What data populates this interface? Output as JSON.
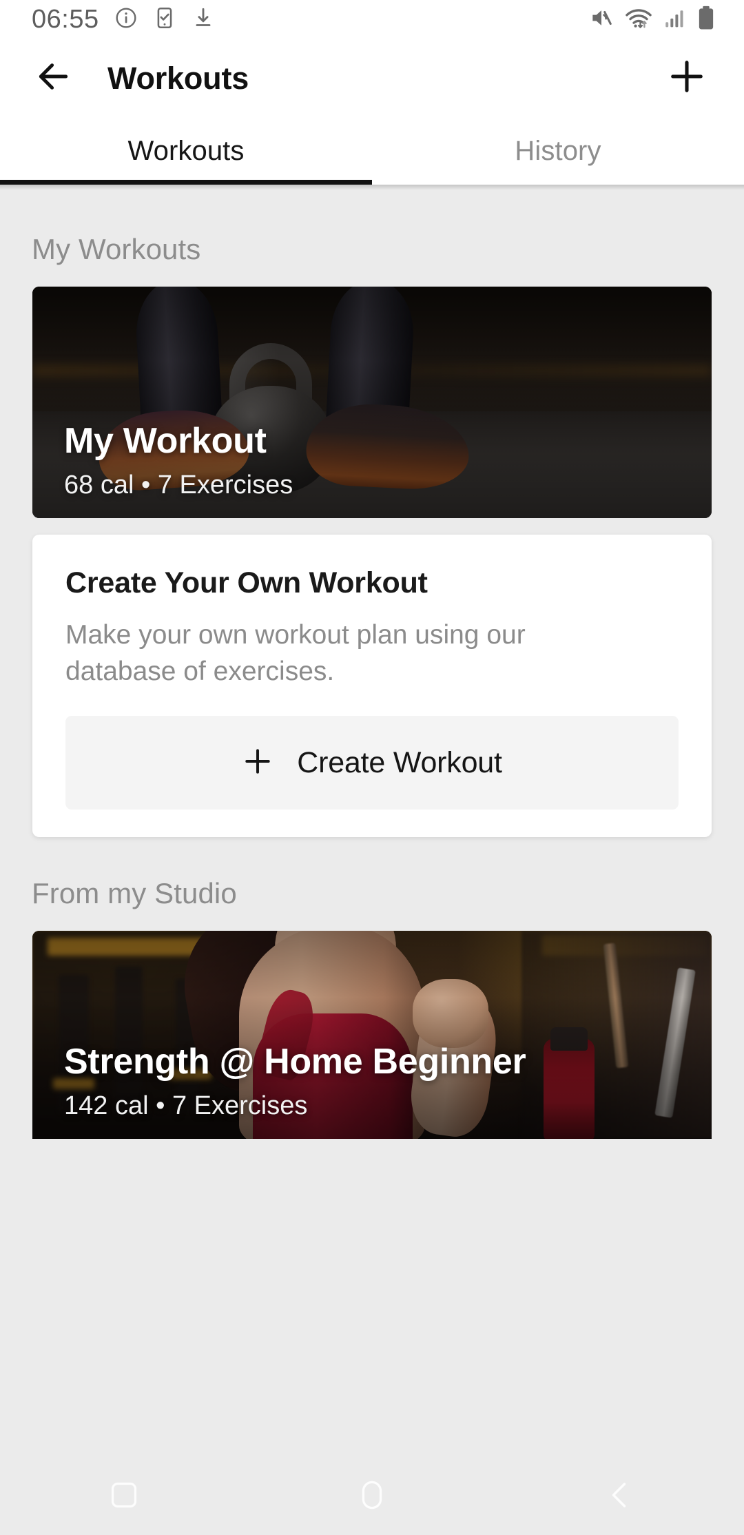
{
  "status_bar": {
    "time": "06:55",
    "left_icons": [
      "info-icon",
      "tasks-icon",
      "download-icon"
    ],
    "right_icons": [
      "mute-icon",
      "wifi-icon",
      "signal-icon",
      "battery-icon"
    ]
  },
  "app_bar": {
    "back_icon": "back-arrow-icon",
    "title": "Workouts",
    "add_icon": "plus-icon"
  },
  "tabs": {
    "items": [
      {
        "label": "Workouts",
        "active": true
      },
      {
        "label": "History",
        "active": false
      }
    ]
  },
  "sections": [
    {
      "title": "My Workouts",
      "hero": {
        "title": "My Workout",
        "subtitle": "68 cal • 7 Exercises",
        "calories": "68 cal",
        "exercises": "7 Exercises"
      },
      "create_card": {
        "title": "Create Your Own Workout",
        "description": "Make your own workout plan using our database of exercises.",
        "button_label": "Create Workout",
        "button_icon": "plus-icon"
      }
    },
    {
      "title": "From my Studio",
      "hero": {
        "title": "Strength @ Home Beginner",
        "subtitle": "142 cal • 7 Exercises",
        "calories": "142 cal",
        "exercises": "7 Exercises"
      }
    }
  ],
  "nav_bar": {
    "recents_icon": "recents-square-icon",
    "home_icon": "home-pill-icon",
    "back_icon": "back-chevron-icon"
  },
  "colors": {
    "page_background": "#ebebeb",
    "surface": "#ffffff",
    "text_primary": "#111111",
    "text_secondary": "#8c8c8c",
    "tab_indicator": "#111111",
    "button_surface": "#f4f4f4"
  }
}
